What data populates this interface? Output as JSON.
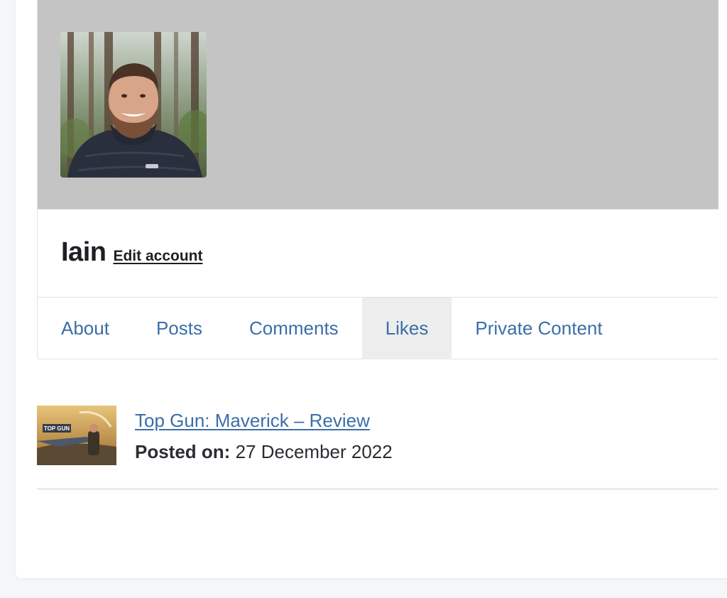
{
  "profile": {
    "display_name": "Iain",
    "edit_account_label": "Edit account",
    "cover_color": "#c4c4c4"
  },
  "tabs": [
    {
      "label": "About",
      "active": false
    },
    {
      "label": "Posts",
      "active": false
    },
    {
      "label": "Comments",
      "active": false
    },
    {
      "label": "Likes",
      "active": true
    },
    {
      "label": "Private Content",
      "active": false
    }
  ],
  "likes": [
    {
      "title": "Top Gun: Maverick – Review",
      "posted_label": "Posted on:",
      "posted_date": "27 December 2022",
      "thumbnail_text": "TOP GUN"
    }
  ],
  "colors": {
    "link": "#3b6ea8",
    "active_tab_bg": "#ededed",
    "text": "#1d1f24"
  }
}
